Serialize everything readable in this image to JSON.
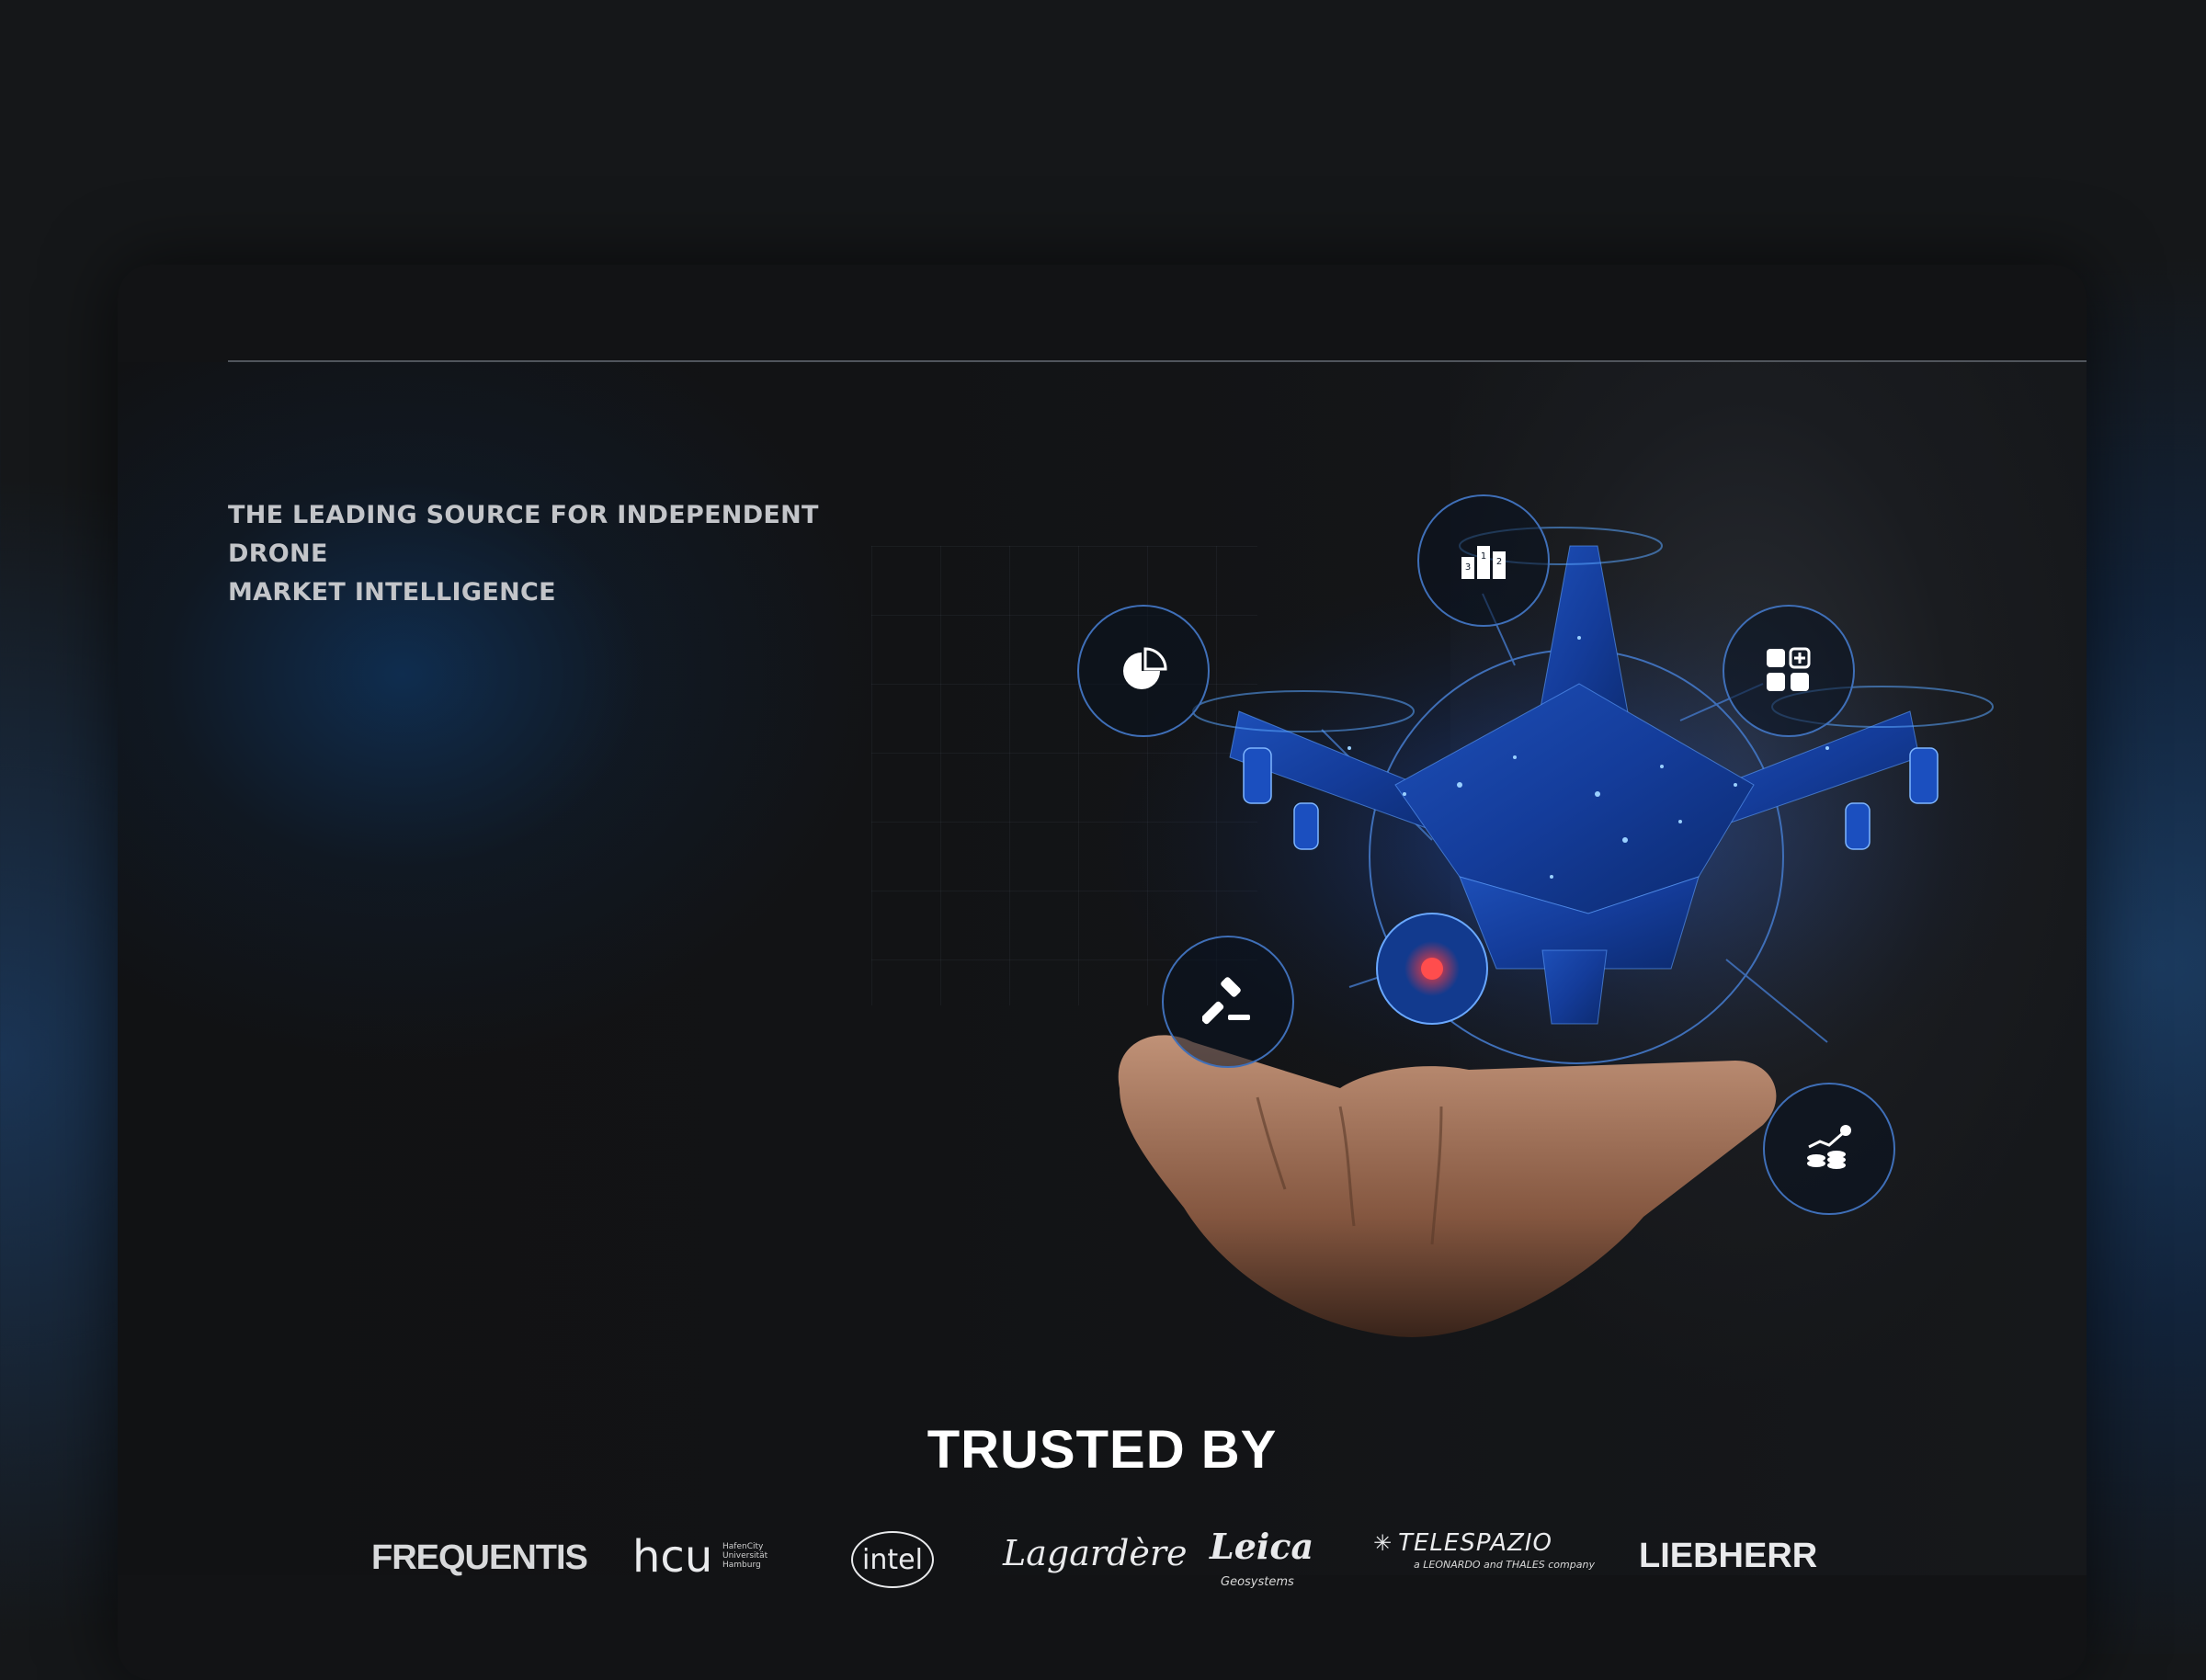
{
  "hero": {
    "tagline_line1": "THE LEADING SOURCE FOR INDEPENDENT DRONE",
    "tagline_line2": "MARKET INTELLIGENCE"
  },
  "feature_icons": [
    {
      "name": "ranking-podium-icon"
    },
    {
      "name": "pie-chart-icon"
    },
    {
      "name": "apps-grid-add-icon"
    },
    {
      "name": "gavel-icon"
    },
    {
      "name": "money-growth-icon"
    }
  ],
  "trusted": {
    "heading": "TRUSTED BY",
    "logos": {
      "frequentis": "FREQUENTIS",
      "hcu": "hcu",
      "hcu_sub": "HafenCity Universität Hamburg",
      "intel": "intel",
      "lagardere": "Lagardère",
      "leica": "Leica",
      "leica_sub": "Geosystems",
      "telespazio": "TELESPAZIO",
      "telespazio_sub": "a LEONARDO and THALES company",
      "liebherr": "LIEBHERR"
    }
  },
  "colors": {
    "accent_blue": "#3f6fb8",
    "background": "#121315",
    "text_light": "#c3c5c9"
  }
}
